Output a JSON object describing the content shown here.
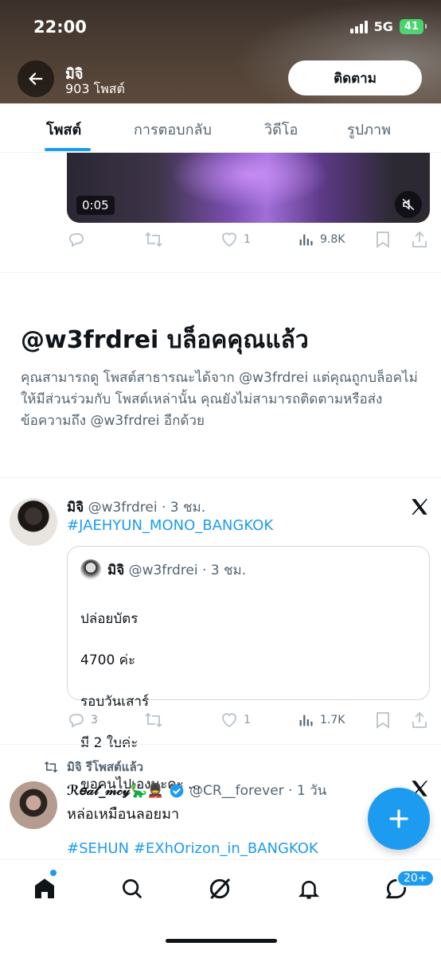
{
  "status_bar": {
    "time": "22:00",
    "network": "5G",
    "battery": "41"
  },
  "header": {
    "name": "มิจิ",
    "post_count": "903 โพสต์",
    "follow_label": "ติดตาม"
  },
  "tabs": [
    {
      "label": "โพสต์"
    },
    {
      "label": "การตอบกลับ"
    },
    {
      "label": "วิดีโอ"
    },
    {
      "label": "รูปภาพ"
    }
  ],
  "video_post": {
    "duration": "0:05",
    "likes": "1",
    "views": "9.8K"
  },
  "blocked": {
    "title": "@w3frdrei บล็อคคุณแล้ว",
    "description": "คุณสามารถดู โพสต์สาธารณะได้จาก @w3frdrei แต่คุณถูกบล็อคไม่ให้มีส่วนร่วมกับ โพสต์เหล่านั้น คุณยังไม่สามารถติดตามหรือส่งข้อความถึง @w3frdrei อีกด้วย"
  },
  "tweet1": {
    "name": "มิจิ",
    "handle_time": "@w3frdrei · 3 ชม.",
    "hashtag": "#JAEHYUN_MONO_BANGKOK",
    "quote": {
      "name": "มิจิ",
      "handle_time": "@w3frdrei · 3 ชม.",
      "lines": [
        "ปล่อยบัตร",
        "4700 ค่ะ",
        "รอบวันเสาร์",
        "มี 2 ใบค่ะ",
        "ขอคนไปเองนะคะ ..."
      ]
    },
    "replies": "3",
    "likes": "1",
    "views": "1.7K"
  },
  "tweet2": {
    "repost_label": "มิจิ รีโพสต์แล้ว",
    "name": "ℛ𝑒𝒶𝓁_𝓂𝒸𝓎🦕💂",
    "handle_time": "@CR__forever · 1 วัน",
    "text": "หล่อเหมือนลอยมา",
    "hashtags": "#SEHUN #EXhOrizon_in_BANGKOK"
  },
  "bottom_nav": {
    "notifications_badge": "20+"
  }
}
